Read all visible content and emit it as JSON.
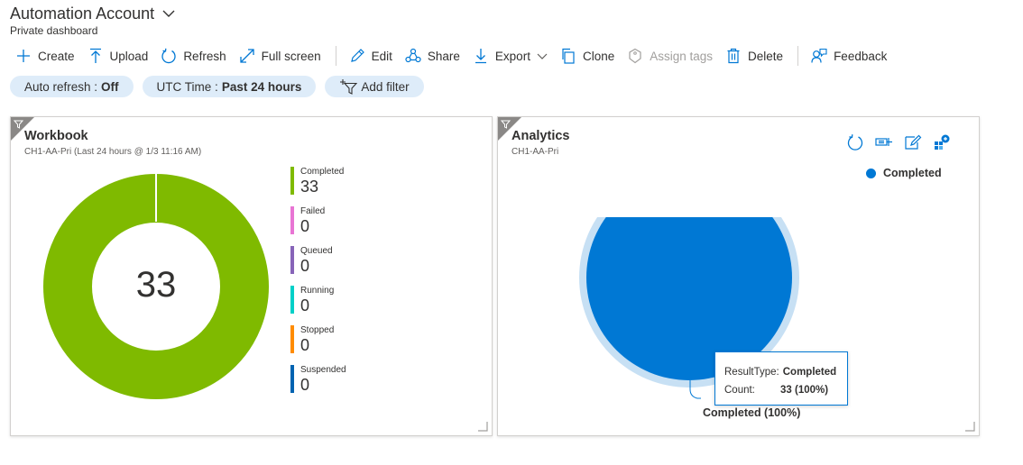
{
  "header": {
    "title": "Automation Account",
    "subtitle": "Private dashboard"
  },
  "toolbar": {
    "create": "Create",
    "upload": "Upload",
    "refresh": "Refresh",
    "fullscreen": "Full screen",
    "edit": "Edit",
    "share": "Share",
    "export": "Export",
    "clone": "Clone",
    "assign_tags": "Assign tags",
    "delete": "Delete",
    "feedback": "Feedback"
  },
  "filters": {
    "auto_refresh_label": "Auto refresh :",
    "auto_refresh_value": "Off",
    "time_label": "UTC Time :",
    "time_value": "Past 24 hours",
    "add_filter": "Add filter"
  },
  "workbook": {
    "title": "Workbook",
    "subtitle": "CH1-AA-Pri (Last 24 hours @ 1/3 11:16 AM)",
    "total": "33",
    "legend": [
      {
        "label": "Completed",
        "value": "33",
        "color": "#7fba00"
      },
      {
        "label": "Failed",
        "value": "0",
        "color": "#e875d4"
      },
      {
        "label": "Queued",
        "value": "0",
        "color": "#8764b8"
      },
      {
        "label": "Running",
        "value": "0",
        "color": "#00d0c8"
      },
      {
        "label": "Stopped",
        "value": "0",
        "color": "#ff8c00"
      },
      {
        "label": "Suspended",
        "value": "0",
        "color": "#0063b1"
      }
    ]
  },
  "analytics": {
    "title": "Analytics",
    "subtitle": "CH1-AA-Pri",
    "legend_label": "Completed",
    "slice_label": "Completed (100%)",
    "tooltip": {
      "key1": "ResultType:",
      "val1": "Completed",
      "key2": "Count:",
      "val2": "33 (100%)"
    },
    "icons": [
      "refresh-icon",
      "pin-icon",
      "edit-query-icon",
      "open-logs-icon"
    ]
  },
  "colors": {
    "accent": "#0078d4",
    "completed_green": "#7fba00",
    "pie_blue": "#0078d4",
    "pie_halo": "#c7e0f4"
  }
}
